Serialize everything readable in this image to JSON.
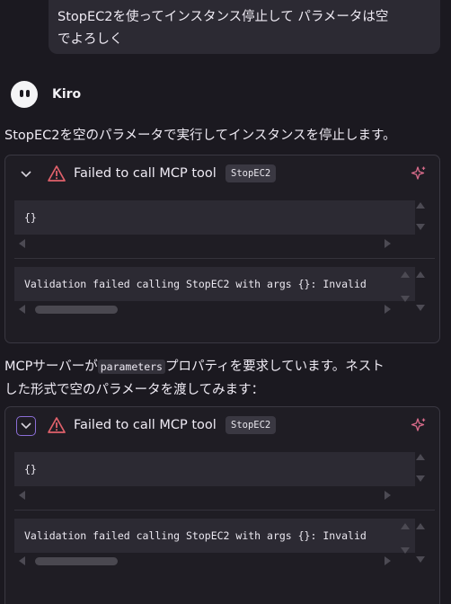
{
  "user_message": {
    "line1": "StopEC2を使ってインスタンス停止して パラメータは空",
    "line2": "でよろしく"
  },
  "bot": {
    "name": "Kiro",
    "avatar_icon": "kiro-ghost-icon"
  },
  "messages": {
    "intro": "StopEC2を空のパラメータで実行してインスタンスを停止します。",
    "followup_prefix": "MCPサーバーが",
    "followup_code": "parameters",
    "followup_suffix": "プロパティを要求しています。ネスト",
    "followup_line2": "した形式で空のパラメータを渡してみます："
  },
  "tool_calls": [
    {
      "title": "Failed to call MCP tool",
      "tool": "StopEC2",
      "args": "{}",
      "error": "Validation failed calling StopEC2 with args {}: Invalid"
    },
    {
      "title": "Failed to call MCP tool",
      "tool": "StopEC2",
      "args": "{}",
      "error": "Validation failed calling StopEC2 with args {}: Invalid"
    }
  ],
  "colors": {
    "warning": "#e0616b",
    "sparkle": "#d86b8a",
    "focus": "#8b6ed6"
  }
}
